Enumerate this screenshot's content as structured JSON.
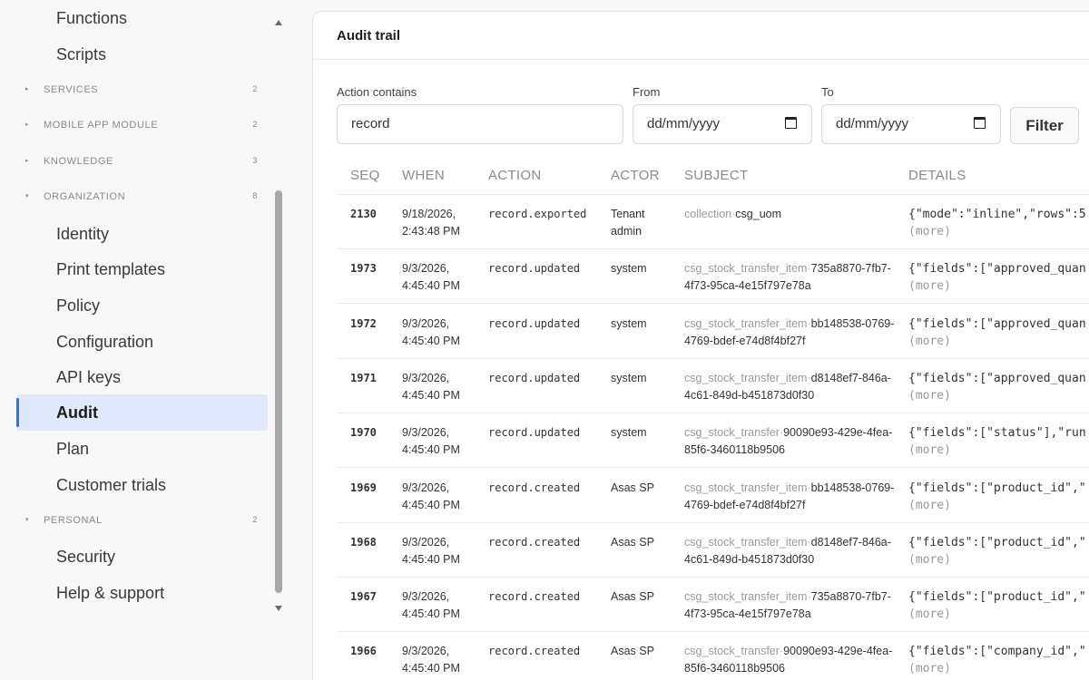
{
  "sidebar": {
    "top_items": [
      "Functions",
      "Scripts"
    ],
    "sections": [
      {
        "label": "SERVICES",
        "count": "2"
      },
      {
        "label": "MOBILE APP MODULE",
        "count": "2"
      },
      {
        "label": "KNOWLEDGE",
        "count": "3"
      },
      {
        "label": "ORGANIZATION",
        "count": "8"
      },
      {
        "label": "PERSONAL",
        "count": "2"
      }
    ],
    "organization_items": [
      "Identity",
      "Print templates",
      "Policy",
      "Configuration",
      "API keys",
      "Audit",
      "Plan",
      "Customer trials"
    ],
    "personal_items": [
      "Security",
      "Help & support"
    ],
    "active_item": "Audit"
  },
  "panel": {
    "title": "Audit trail",
    "filters": {
      "action_label": "Action contains",
      "action_value": "record",
      "from_label": "From",
      "from_placeholder": "dd/mm/yyyy",
      "to_label": "To",
      "to_placeholder": "dd/mm/yyyy",
      "filter_button": "Filter"
    },
    "table": {
      "headers": [
        "SEQ",
        "WHEN",
        "ACTION",
        "ACTOR",
        "SUBJECT",
        "DETAILS"
      ],
      "rows": [
        {
          "seq": "2130",
          "when": "9/18/2026, 2:43:48 PM",
          "action": "record.exported",
          "actor": "Tenant admin",
          "subject_collection": "collection",
          "subject_id": "csg_uom",
          "details": "{\"mode\":\"inline\",\"rows\":5",
          "more": "(more)"
        },
        {
          "seq": "1973",
          "when": "9/3/2026, 4:45:40 PM",
          "action": "record.updated",
          "actor": "system",
          "subject_collection": "csg_stock_transfer_item",
          "subject_id": "735a8870-7fb7-4f73-95ca-4e15f797e78a",
          "details": "{\"fields\":[\"approved_quan",
          "more": "(more)"
        },
        {
          "seq": "1972",
          "when": "9/3/2026, 4:45:40 PM",
          "action": "record.updated",
          "actor": "system",
          "subject_collection": "csg_stock_transfer_item",
          "subject_id": "bb148538-0769-4769-bdef-e74d8f4bf27f",
          "details": "{\"fields\":[\"approved_quan",
          "more": "(more)"
        },
        {
          "seq": "1971",
          "when": "9/3/2026, 4:45:40 PM",
          "action": "record.updated",
          "actor": "system",
          "subject_collection": "csg_stock_transfer_item",
          "subject_id": "d8148ef7-846a-4c61-849d-b451873d0f30",
          "details": "{\"fields\":[\"approved_quan",
          "more": "(more)"
        },
        {
          "seq": "1970",
          "when": "9/3/2026, 4:45:40 PM",
          "action": "record.updated",
          "actor": "system",
          "subject_collection": "csg_stock_transfer",
          "subject_id": "90090e93-429e-4fea-85f6-3460118b9506",
          "details": "{\"fields\":[\"status\"],\"run",
          "more": "(more)"
        },
        {
          "seq": "1969",
          "when": "9/3/2026, 4:45:40 PM",
          "action": "record.created",
          "actor": "Asas SP",
          "subject_collection": "csg_stock_transfer_item",
          "subject_id": "bb148538-0769-4769-bdef-e74d8f4bf27f",
          "details": "{\"fields\":[\"product_id\",\"",
          "more": "(more)"
        },
        {
          "seq": "1968",
          "when": "9/3/2026, 4:45:40 PM",
          "action": "record.created",
          "actor": "Asas SP",
          "subject_collection": "csg_stock_transfer_item",
          "subject_id": "d8148ef7-846a-4c61-849d-b451873d0f30",
          "details": "{\"fields\":[\"product_id\",\"",
          "more": "(more)"
        },
        {
          "seq": "1967",
          "when": "9/3/2026, 4:45:40 PM",
          "action": "record.created",
          "actor": "Asas SP",
          "subject_collection": "csg_stock_transfer_item",
          "subject_id": "735a8870-7fb7-4f73-95ca-4e15f797e78a",
          "details": "{\"fields\":[\"product_id\",\"",
          "more": "(more)"
        },
        {
          "seq": "1966",
          "when": "9/3/2026, 4:45:40 PM",
          "action": "record.created",
          "actor": "Asas SP",
          "subject_collection": "csg_stock_transfer",
          "subject_id": "90090e93-429e-4fea-85f6-3460118b9506",
          "details": "{\"fields\":[\"company_id\",\"",
          "more": "(more)"
        }
      ]
    }
  },
  "colors": {
    "accent": "#3b6fd4",
    "active_bg": "#dfe9fb"
  }
}
